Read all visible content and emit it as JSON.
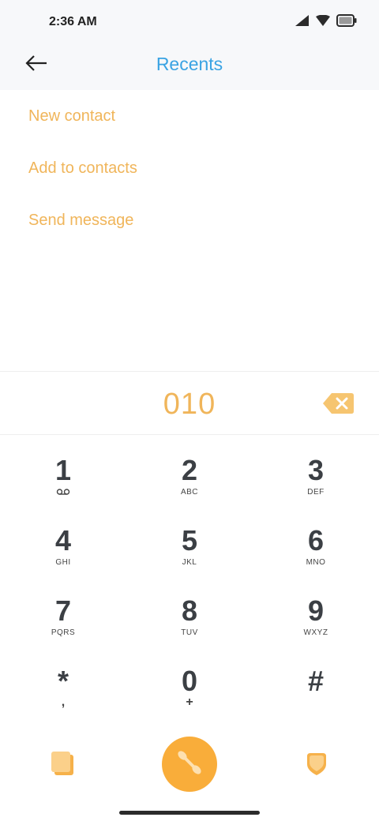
{
  "status": {
    "time": "2:36 AM",
    "icons": [
      "signal-icon",
      "wifi-icon",
      "battery-icon"
    ]
  },
  "header": {
    "title": "Recents",
    "back_icon": "back-arrow-icon"
  },
  "menu": {
    "items": [
      {
        "label": "New contact"
      },
      {
        "label": "Add to contacts"
      },
      {
        "label": "Send message"
      }
    ]
  },
  "dialer": {
    "number": "010",
    "backspace_icon": "backspace-icon"
  },
  "keypad": {
    "keys": [
      {
        "digit": "1",
        "sub": ""
      },
      {
        "digit": "2",
        "sub": "ABC"
      },
      {
        "digit": "3",
        "sub": "DEF"
      },
      {
        "digit": "4",
        "sub": "GHI"
      },
      {
        "digit": "5",
        "sub": "JKL"
      },
      {
        "digit": "6",
        "sub": "MNO"
      },
      {
        "digit": "7",
        "sub": "PQRS"
      },
      {
        "digit": "8",
        "sub": "TUV"
      },
      {
        "digit": "9",
        "sub": "WXYZ"
      },
      {
        "digit": "*",
        "sub": ","
      },
      {
        "digit": "0",
        "sub": "+"
      },
      {
        "digit": "#",
        "sub": ""
      }
    ]
  },
  "actions": {
    "left_icon": "contacts-icon",
    "call_icon": "phone-icon",
    "right_icon": "favorites-icon"
  },
  "colors": {
    "accent": "#f0b55a",
    "call_button": "#f9ad3a",
    "title": "#3aa3e3",
    "digit": "#3b3f44"
  }
}
